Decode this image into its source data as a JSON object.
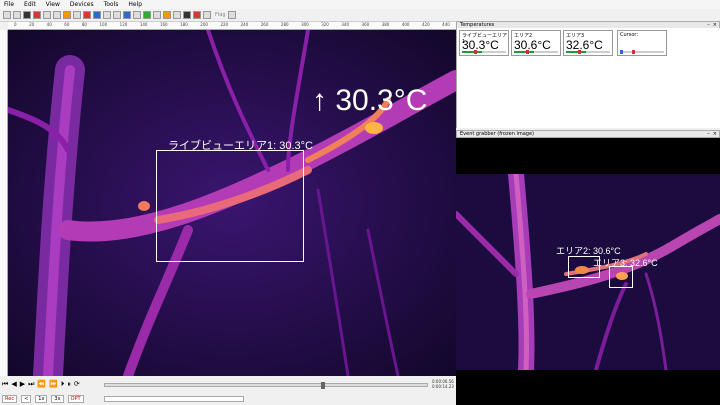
{
  "menu": {
    "items": [
      "File",
      "Edit",
      "View",
      "Devices",
      "Tools",
      "Help"
    ]
  },
  "toolbar": {
    "flag_label": "Flag"
  },
  "ruler": {
    "ticks": [
      "0",
      "20",
      "40",
      "60",
      "80",
      "100",
      "120",
      "140",
      "160",
      "180",
      "200",
      "220",
      "240",
      "260",
      "280",
      "300",
      "320",
      "340",
      "360",
      "380",
      "400",
      "420",
      "440"
    ]
  },
  "live_view": {
    "big_temperature": "↑ 30.3°C",
    "roi_label": "ライブビューエリア1: 30.3°C"
  },
  "temperatures_panel": {
    "title": "Temperatures",
    "cards": [
      {
        "name": "ライブビューエリア1",
        "value": "30.3°C",
        "level": 0.45
      },
      {
        "name": "エリア2",
        "value": "30.6°C",
        "level": 0.45
      },
      {
        "name": "エリア3",
        "value": "32.6°C",
        "level": 0.45
      },
      {
        "name": "Cursor:",
        "value": "",
        "level": 0.0
      }
    ]
  },
  "event_grabber": {
    "title": "Event grabber (frozen image)",
    "roi2_label": "エリア2: 30.6°C",
    "roi3_label": "エリア3: 32.6°C"
  },
  "transport": {
    "buttons": [
      "⏮",
      "◀",
      "▶",
      "⏭",
      "⏪",
      "⏩",
      "⏵",
      "⏸",
      "⟳"
    ],
    "time_current": "0:00:06.56",
    "time_total": "0:00:14.23",
    "position": 0.67,
    "row2": [
      "Rec",
      "≺",
      "1x",
      "3x",
      "OPT"
    ]
  },
  "colors": {
    "ironbow_dark": "#1a0b3a",
    "ironbow_mid": "#8a1fa8",
    "ironbow_hot": "#ffb347",
    "bar_green": "#1a9c3a"
  }
}
